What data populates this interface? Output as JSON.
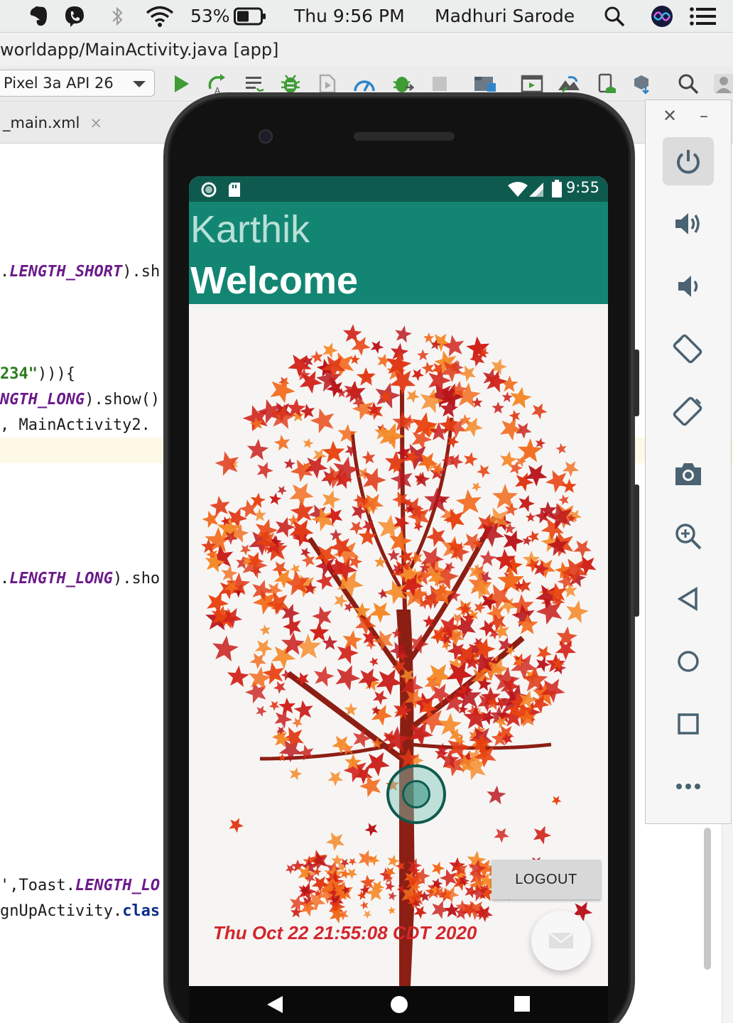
{
  "menubar": {
    "battery_percent": "53%",
    "clock": "Thu 9:56 PM",
    "user_name": "Madhuri Sarode"
  },
  "ide": {
    "title": "worldapp/MainActivity.java [app]",
    "device": "Pixel 3a API 26",
    "tab_label": "_main.xml",
    "tab_close": "×",
    "code_lines": {
      "l1a": ".",
      "l1b": "LENGTH_SHORT",
      "l1c": ").sh",
      "l2a": "234\"",
      "l2b": "))){",
      "l3a": "NGTH_LONG",
      "l3b": ").show()",
      "l4a": ", MainActivity2.",
      "l5a": ".",
      "l5b": "LENGTH_LONG",
      "l5c": ").sho",
      "l6a": "',Toast.",
      "l6b": "LENGTH_LO",
      "l7a": "gnUpActivity.",
      "l7b": "clas"
    }
  },
  "emulator": {
    "status_time": "9:55",
    "app_name": "Karthik",
    "welcome": "Welcome",
    "logout_label": "LOGOUT",
    "date_text": "Thu Oct 22 21:55:08 CDT 2020"
  },
  "colors": {
    "status_bar": "#0f5a4e",
    "app_bar": "#138673",
    "date_text": "#d3262b"
  }
}
